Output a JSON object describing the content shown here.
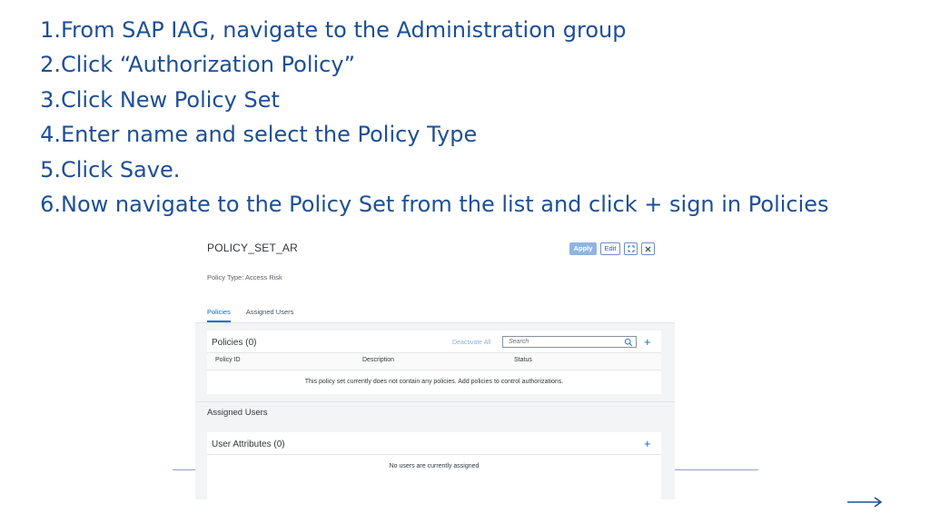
{
  "steps": [
    {
      "num": "1.",
      "text": "From SAP IAG, navigate to the Administration group"
    },
    {
      "num": "2.",
      "text": "Click “Authorization Policy”"
    },
    {
      "num": "3.",
      "text": "Click New Policy Set"
    },
    {
      "num": "4.",
      "text": "Enter name and select the Policy Type"
    },
    {
      "num": "5.",
      "text": "Click Save."
    },
    {
      "num": "6.",
      "text": "Now navigate to the Policy Set from the list and click + sign in Policies"
    }
  ],
  "panel": {
    "title": "POLICY_SET_AR",
    "toolbar": {
      "apply_label": "Apply",
      "edit_label": "Edit"
    },
    "policy_type": "Policy Type: Access Risk",
    "tabs": [
      {
        "label": "Policies",
        "active": true
      },
      {
        "label": "Assigned Users",
        "active": false
      }
    ],
    "policies": {
      "title": "Policies (0)",
      "deactivate_all": "Deactivate All",
      "search_placeholder": "Search",
      "add_symbol": "+",
      "columns": [
        "Policy ID",
        "Description",
        "Status"
      ],
      "empty_text": "This policy set currently does not contain any policies. Add policies to control authorizations."
    },
    "assigned_users_label": "Assigned Users",
    "user_attributes": {
      "title": "User Attributes (0)",
      "add_symbol": "+",
      "empty_text": "No users are currently assigned"
    }
  },
  "colors": {
    "step_text": "#1d4f96",
    "accent": "#0a6ed1",
    "apply_button": "#90b4e2"
  },
  "icons": {
    "search": "search-icon",
    "expand": "expand-icon",
    "close": "close-icon",
    "next": "arrow-right-icon"
  }
}
